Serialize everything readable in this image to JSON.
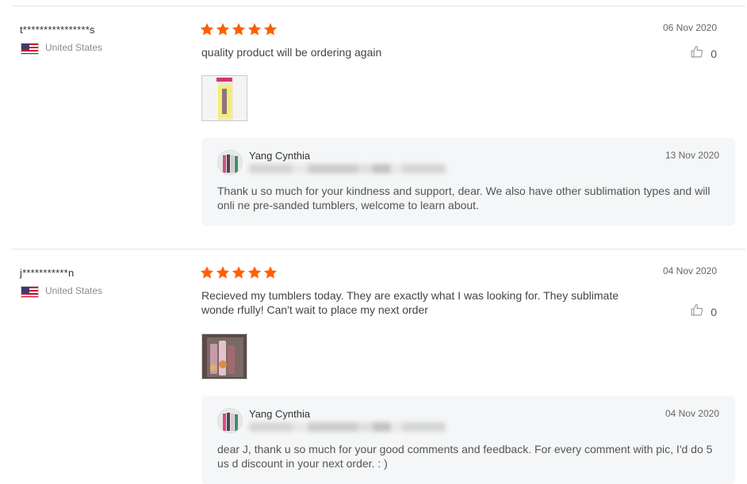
{
  "reviews": [
    {
      "user": "t****************s",
      "country": "United States",
      "rating": 5,
      "date": "06 Nov 2020",
      "text": "quality product will be ordering again",
      "likes": "0",
      "photo_count": 1,
      "reply": {
        "seller": "Yang Cynthia",
        "date": "13 Nov 2020",
        "text": "Thank u so much for your kindness and support, dear. We also have other sublimation types and will onli ne pre-sanded tumblers, welcome to learn about."
      }
    },
    {
      "user": "j***********n",
      "country": "United States",
      "rating": 5,
      "date": "04 Nov 2020",
      "text": "Recieved my tumblers today. They are exactly what I was looking for. They sublimate wonde rfully!  Can't wait to place my next order",
      "likes": "0",
      "photo_count": 1,
      "reply": {
        "seller": "Yang Cynthia",
        "date": "04 Nov 2020",
        "text": "dear J, thank u so much for your good comments and feedback. For every comment with pic, I'd do 5 us d discount in your next order. : )"
      }
    }
  ],
  "colors": {
    "star": "#ff6000",
    "reply_bg": "#f5f6f7",
    "divider": "#e6e6e6"
  },
  "icons": {
    "star": "star-icon",
    "like": "thumbs-up-icon",
    "flag": "us-flag-icon"
  }
}
